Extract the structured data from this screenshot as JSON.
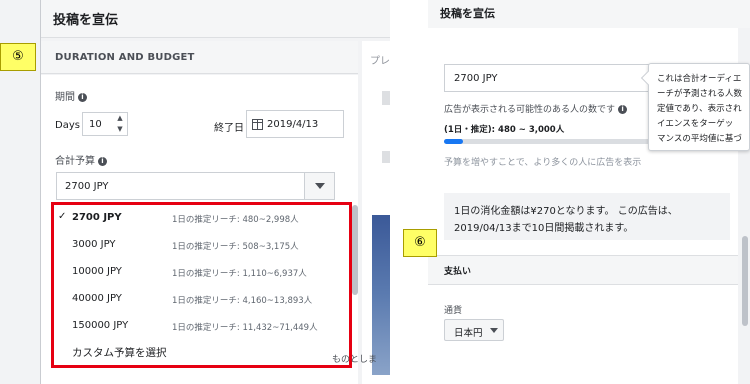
{
  "left": {
    "dialog_title": "投稿を宣伝",
    "badge": "⑤",
    "section_title": "DURATION AND BUDGET",
    "period_label": "期間",
    "days_label": "Days",
    "days_value": "10",
    "end_date_label": "終了日",
    "end_date_value": "2019/4/13",
    "budget_label": "合計予算",
    "budget_selected": "2700 JPY",
    "preview_label": "プレ",
    "preview_trailing": "ものとしま",
    "dropdown": {
      "options": [
        {
          "amount": "2700 JPY",
          "reach": "1日の推定リーチ: 480~2,998人",
          "selected": true
        },
        {
          "amount": "3000 JPY",
          "reach": "1日の推定リーチ: 508~3,175人",
          "selected": false
        },
        {
          "amount": "10000 JPY",
          "reach": "1日の推定リーチ: 1,110~6,937人",
          "selected": false
        },
        {
          "amount": "40000 JPY",
          "reach": "1日の推定リーチ: 4,160~13,893人",
          "selected": false
        },
        {
          "amount": "150000 JPY",
          "reach": "1日の推定リーチ: 11,432~71,449人",
          "selected": false
        }
      ],
      "check_mark": "✓",
      "custom_label": "カスタム予算を選択",
      "highlight_color": "#e60012"
    }
  },
  "right": {
    "dialog_title": "投稿を宣伝",
    "budget_selected": "2700 JPY",
    "reach_label": "広告が表示される可能性のある人の数です",
    "reach_value": "(1日・推定): 480 ~ 3,000人",
    "reach_level_percent": 9,
    "hint": "予算を増やすことで、より多くの人に広告を表示",
    "tooltip_lines": [
      "これは合計オーディエ",
      "ーチが予測される人数",
      "定値であり、表示され",
      "イエンスをターゲッ",
      "マンスの平均値に基づ"
    ],
    "summary_line1": "1日の消化金額は¥270となります。 この広告は、",
    "summary_line2": "2019/04/13まで10日間掲載されます。",
    "badge": "⑥",
    "payment_title": "支払い",
    "currency_label": "通貨",
    "currency_value": "日本円"
  },
  "colors": {
    "accent": "#1877f2",
    "badge": "#ffff66",
    "highlight": "#e60012"
  },
  "icons": [
    "info-icon",
    "calendar-icon",
    "chevron-down-icon",
    "stepper-up-icon",
    "stepper-down-icon"
  ]
}
